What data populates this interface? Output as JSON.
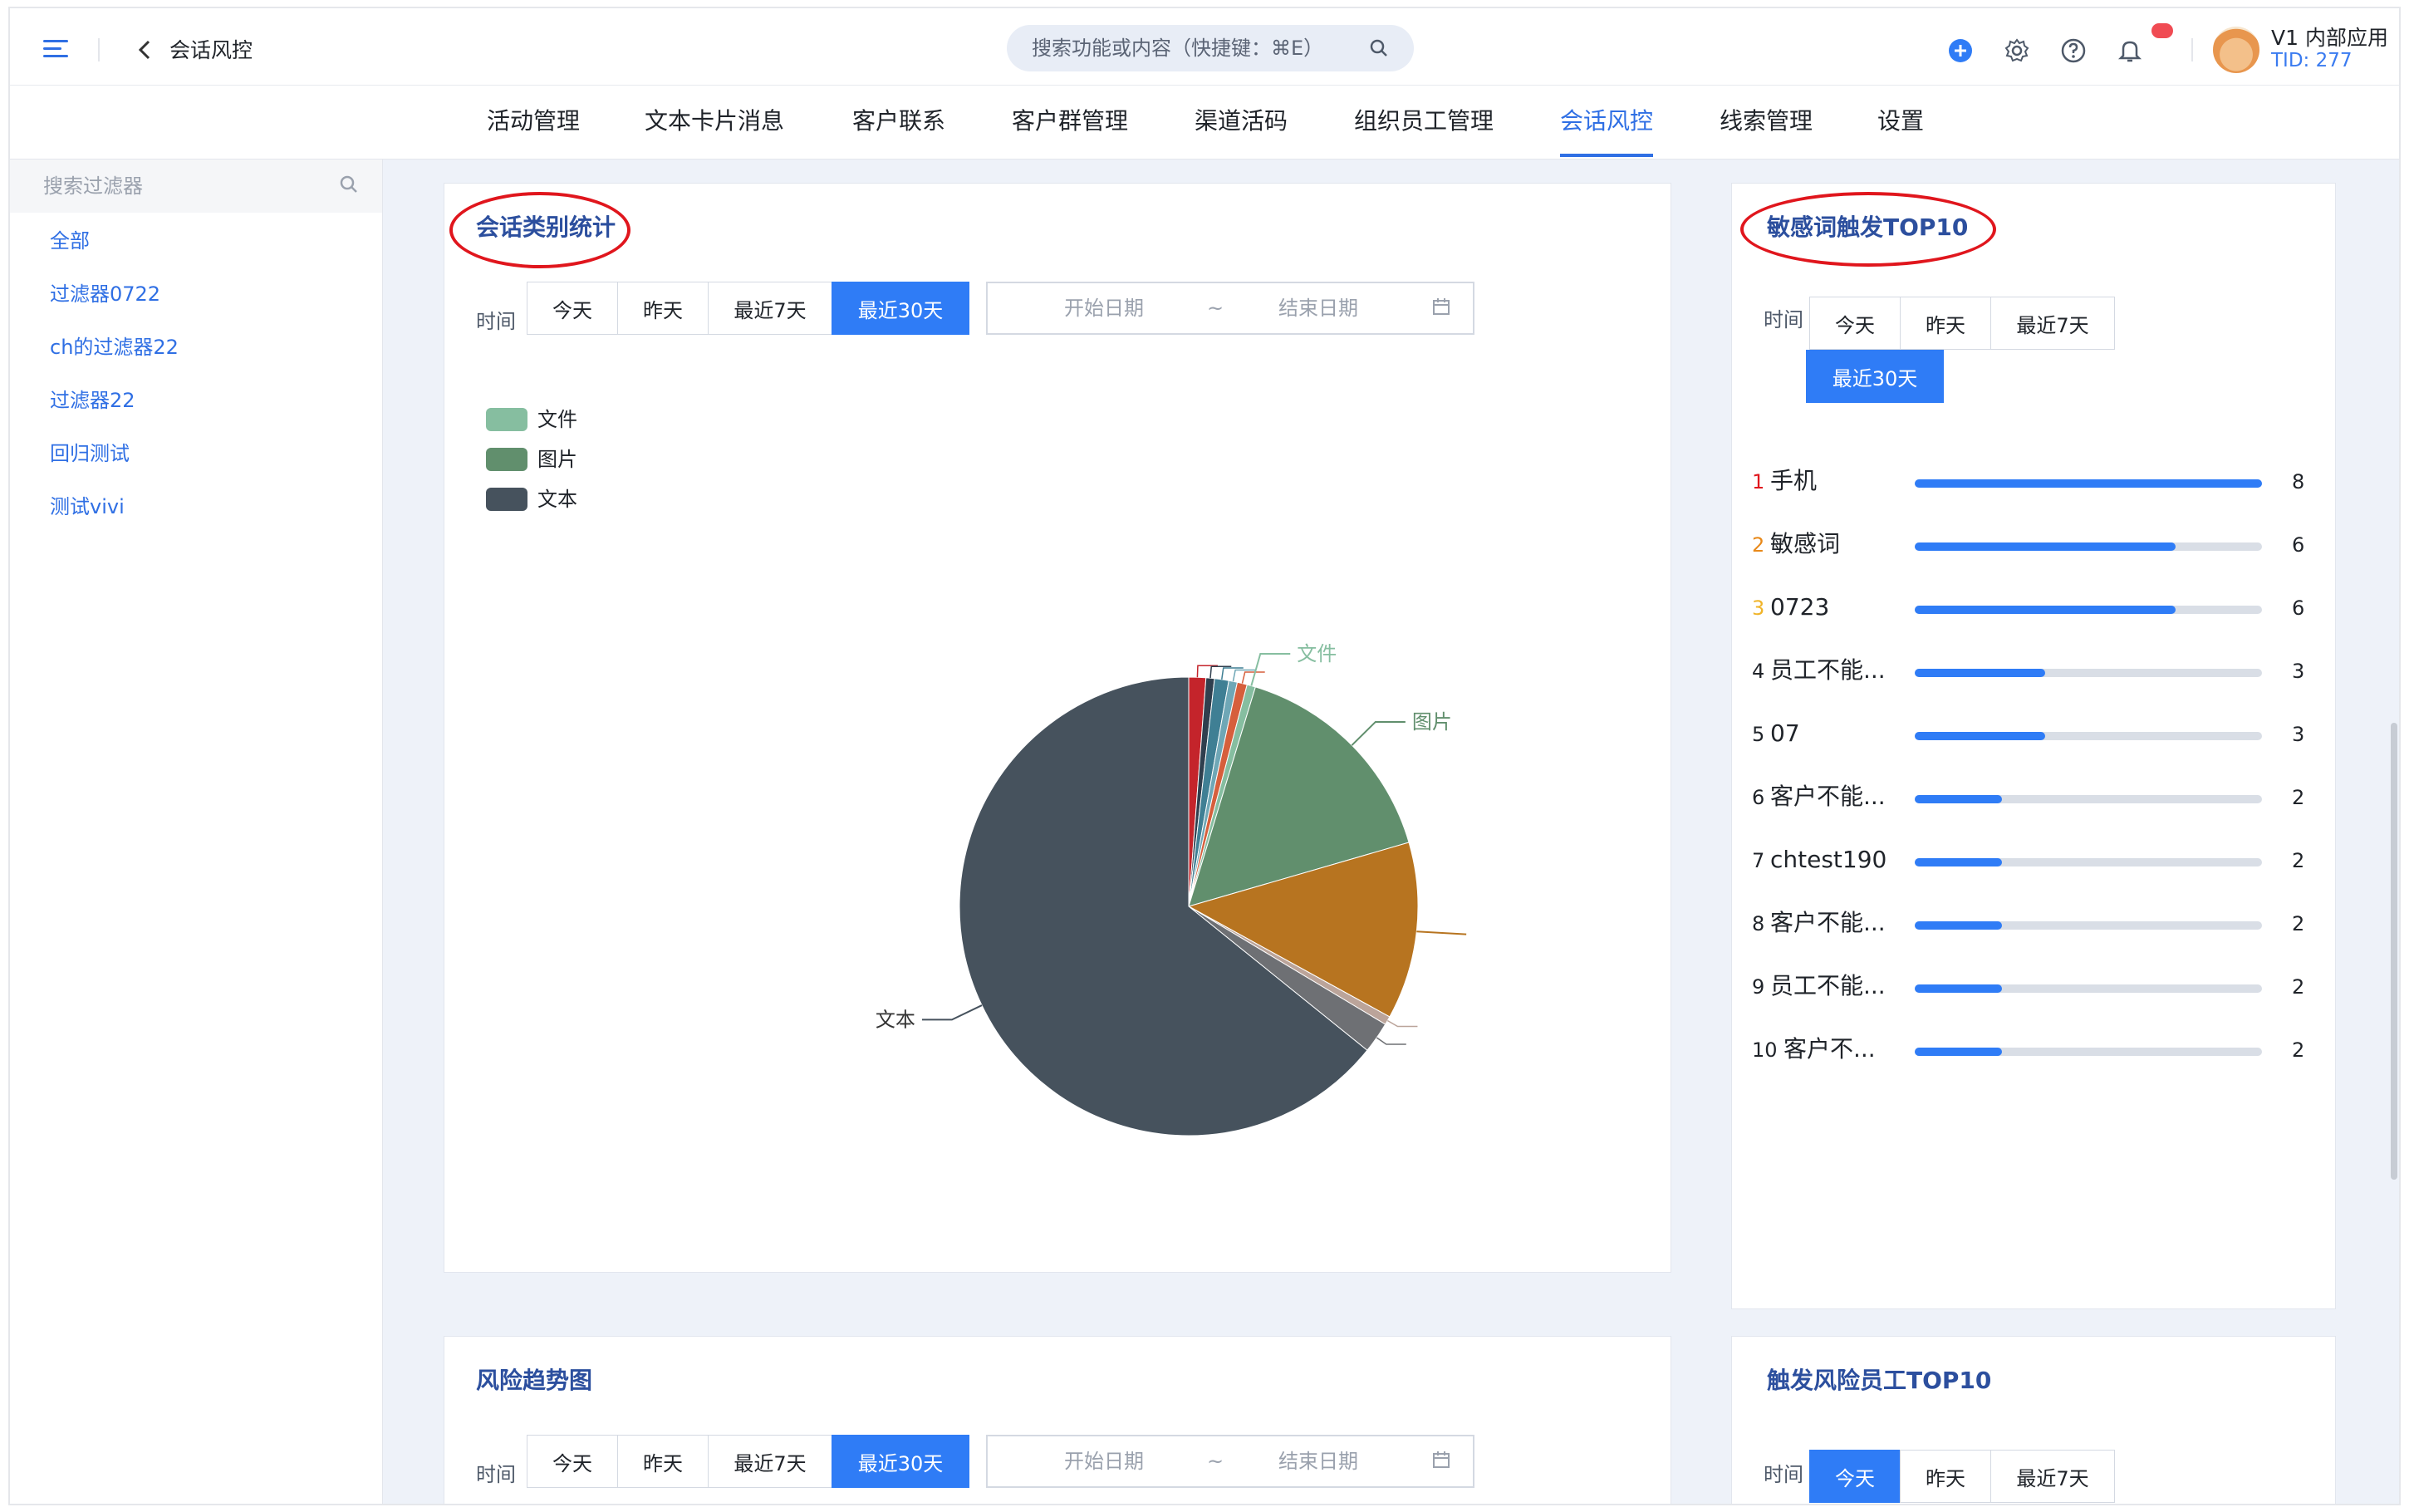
{
  "topbar": {
    "breadcrumb": "会话风控",
    "search_placeholder": "搜索功能或内容（快捷键：⌘E）",
    "app_name": "V1 内部应用",
    "tid": "TID: 277"
  },
  "nav": {
    "tabs": [
      {
        "label": "活动管理"
      },
      {
        "label": "文本卡片消息"
      },
      {
        "label": "客户联系"
      },
      {
        "label": "客户群管理"
      },
      {
        "label": "渠道活码"
      },
      {
        "label": "组织员工管理"
      },
      {
        "label": "会话风控"
      },
      {
        "label": "线索管理"
      },
      {
        "label": "设置"
      }
    ],
    "active_index": 6
  },
  "sidebar": {
    "search_placeholder": "搜索过滤器",
    "items": [
      {
        "label": "全部"
      },
      {
        "label": "过滤器0722"
      },
      {
        "label": "ch的过滤器22"
      },
      {
        "label": "过滤器22"
      },
      {
        "label": "回归测试"
      },
      {
        "label": "测试vivi"
      }
    ]
  },
  "filters": {
    "time_label": "时间",
    "today": "今天",
    "yesterday": "昨天",
    "last7": "最近7天",
    "last30": "最近30天",
    "start_date": "开始日期",
    "range_sep": "~",
    "end_date": "结束日期"
  },
  "session_stats": {
    "title": "会话类别统计",
    "active_filter": "最近30天",
    "chart_data": {
      "type": "pie",
      "legend": [
        "文件",
        "图片",
        "文本"
      ],
      "callout_labels": [
        "文件",
        "图片",
        "文本"
      ],
      "slices": [
        {
          "value": 1.2,
          "color": "#c4242b"
        },
        {
          "value": 0.6,
          "color": "#2f3f4e"
        },
        {
          "value": 1.0,
          "color": "#3f7f94"
        },
        {
          "value": 0.6,
          "color": "#6fa7b6"
        },
        {
          "value": 0.7,
          "color": "#d65f3c"
        },
        {
          "value": 0.6,
          "color": "#86bea0",
          "label": "文件"
        },
        {
          "value": 15.8,
          "color": "#618f6d",
          "label": "图片"
        },
        {
          "value": 12.5,
          "color": "#b77420"
        },
        {
          "value": 0.6,
          "color": "#bba49a"
        },
        {
          "value": 2.2,
          "color": "#6e7074"
        },
        {
          "value": 64.2,
          "color": "#46525d",
          "label": "文本"
        }
      ],
      "legend_colors": [
        "#86bea0",
        "#618f6d",
        "#46525d"
      ]
    }
  },
  "sensitive_top": {
    "title": "敏感词触发TOP10",
    "active_filter": "最近30天",
    "rank_colors": {
      "1": "#e0161d",
      "2": "#e8891a",
      "3": "#f0b429",
      "default": "#1f2329"
    },
    "max": 8,
    "items": [
      {
        "rank": "1",
        "label": "手机",
        "value": 8
      },
      {
        "rank": "2",
        "label": "敏感词",
        "value": 6
      },
      {
        "rank": "3",
        "label": "0723",
        "value": 6
      },
      {
        "rank": "4",
        "label": "员工不能...",
        "value": 3
      },
      {
        "rank": "5",
        "label": "07",
        "value": 3
      },
      {
        "rank": "6",
        "label": "客户不能...",
        "value": 2
      },
      {
        "rank": "7",
        "label": "chtest190",
        "value": 2
      },
      {
        "rank": "8",
        "label": "客户不能...",
        "value": 2
      },
      {
        "rank": "9",
        "label": "员工不能...",
        "value": 2
      },
      {
        "rank": "10",
        "label": "客户不...",
        "value": 2
      }
    ]
  },
  "risk_trend": {
    "title": "风险趋势图",
    "active_filter": "最近30天"
  },
  "risk_employee_top": {
    "title": "触发风险员工TOP10",
    "active_filter": "今天"
  },
  "colors": {
    "accent": "#2f7cf6",
    "title": "#2c4f9e",
    "annotation": "#e0161d"
  }
}
